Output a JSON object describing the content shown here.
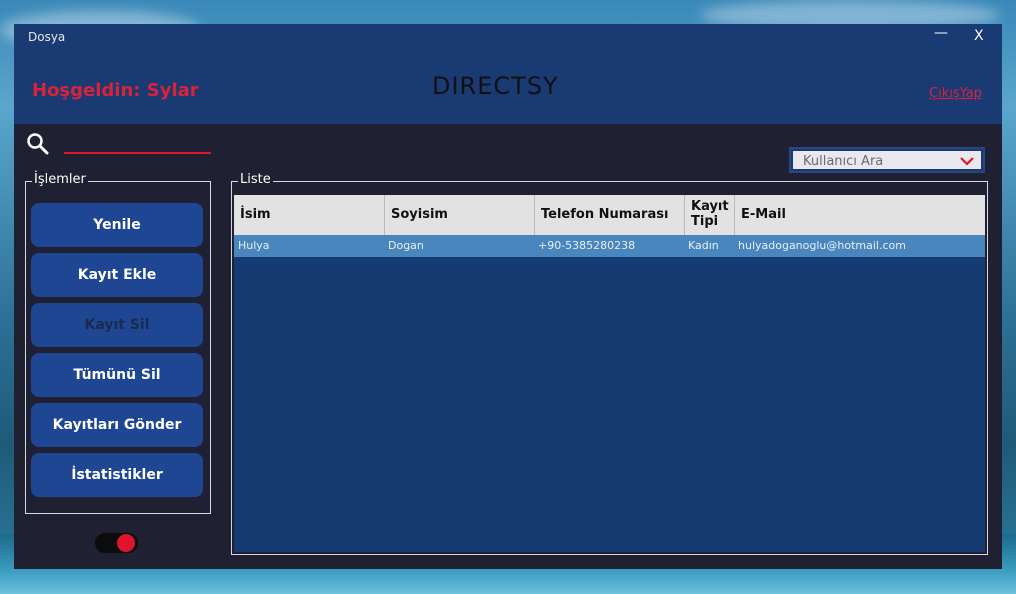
{
  "window": {
    "title": "Dosya",
    "minimize_label": "—",
    "close_label": "X"
  },
  "header": {
    "welcome": "Hoşgeldin: Sylar",
    "app_title": "DIRECTSY",
    "logout": "ÇıkışYap"
  },
  "search": {
    "placeholder": ""
  },
  "dropdown": {
    "selected": "Kullanıcı Ara"
  },
  "operations": {
    "legend": "İşlemler",
    "buttons": [
      "Yenile",
      "Kayıt Ekle",
      "Kayıt Sil",
      "Tümünü Sil",
      "Kayıtları Gönder",
      "İstatistikler"
    ]
  },
  "list": {
    "legend": "Liste",
    "columns": [
      "İsim",
      "Soyisim",
      "Telefon Numarası",
      "Kayıt Tipi",
      "E-Mail"
    ],
    "rows": [
      [
        "Hulya",
        "Dogan",
        "+90-5385280238",
        "Kadın",
        "hulyadoganoglu@hotmail.com"
      ]
    ]
  },
  "colors": {
    "accent_red": "#e0142d",
    "header_blue": "#1a3a73",
    "button_blue": "#1e4692",
    "row_selected": "#4a86be"
  }
}
